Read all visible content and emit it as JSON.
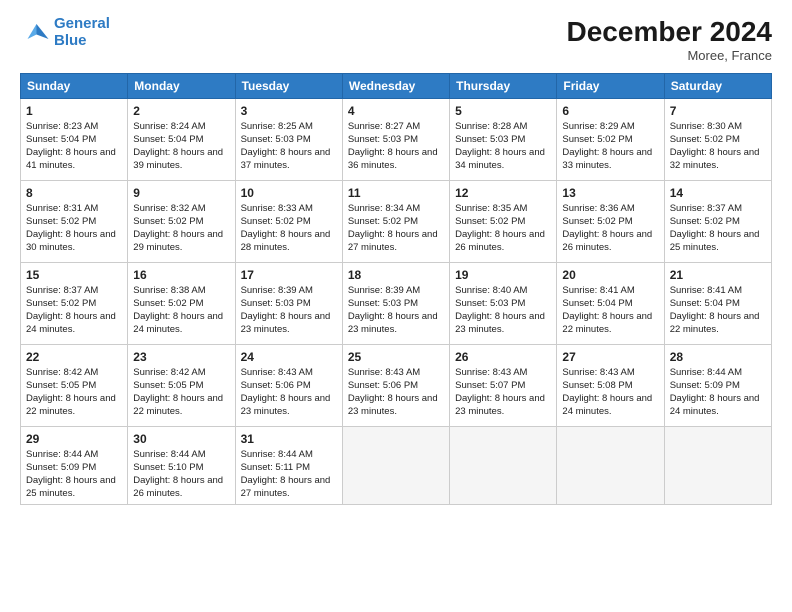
{
  "header": {
    "logo_line1": "General",
    "logo_line2": "Blue",
    "month": "December 2024",
    "location": "Moree, France"
  },
  "weekdays": [
    "Sunday",
    "Monday",
    "Tuesday",
    "Wednesday",
    "Thursday",
    "Friday",
    "Saturday"
  ],
  "weeks": [
    [
      {
        "day": 1,
        "sunrise": "8:23 AM",
        "sunset": "5:04 PM",
        "daylight": "8 hours and 41 minutes."
      },
      {
        "day": 2,
        "sunrise": "8:24 AM",
        "sunset": "5:04 PM",
        "daylight": "8 hours and 39 minutes."
      },
      {
        "day": 3,
        "sunrise": "8:25 AM",
        "sunset": "5:03 PM",
        "daylight": "8 hours and 37 minutes."
      },
      {
        "day": 4,
        "sunrise": "8:27 AM",
        "sunset": "5:03 PM",
        "daylight": "8 hours and 36 minutes."
      },
      {
        "day": 5,
        "sunrise": "8:28 AM",
        "sunset": "5:03 PM",
        "daylight": "8 hours and 34 minutes."
      },
      {
        "day": 6,
        "sunrise": "8:29 AM",
        "sunset": "5:02 PM",
        "daylight": "8 hours and 33 minutes."
      },
      {
        "day": 7,
        "sunrise": "8:30 AM",
        "sunset": "5:02 PM",
        "daylight": "8 hours and 32 minutes."
      }
    ],
    [
      {
        "day": 8,
        "sunrise": "8:31 AM",
        "sunset": "5:02 PM",
        "daylight": "8 hours and 30 minutes."
      },
      {
        "day": 9,
        "sunrise": "8:32 AM",
        "sunset": "5:02 PM",
        "daylight": "8 hours and 29 minutes."
      },
      {
        "day": 10,
        "sunrise": "8:33 AM",
        "sunset": "5:02 PM",
        "daylight": "8 hours and 28 minutes."
      },
      {
        "day": 11,
        "sunrise": "8:34 AM",
        "sunset": "5:02 PM",
        "daylight": "8 hours and 27 minutes."
      },
      {
        "day": 12,
        "sunrise": "8:35 AM",
        "sunset": "5:02 PM",
        "daylight": "8 hours and 26 minutes."
      },
      {
        "day": 13,
        "sunrise": "8:36 AM",
        "sunset": "5:02 PM",
        "daylight": "8 hours and 26 minutes."
      },
      {
        "day": 14,
        "sunrise": "8:37 AM",
        "sunset": "5:02 PM",
        "daylight": "8 hours and 25 minutes."
      }
    ],
    [
      {
        "day": 15,
        "sunrise": "8:37 AM",
        "sunset": "5:02 PM",
        "daylight": "8 hours and 24 minutes."
      },
      {
        "day": 16,
        "sunrise": "8:38 AM",
        "sunset": "5:02 PM",
        "daylight": "8 hours and 24 minutes."
      },
      {
        "day": 17,
        "sunrise": "8:39 AM",
        "sunset": "5:03 PM",
        "daylight": "8 hours and 23 minutes."
      },
      {
        "day": 18,
        "sunrise": "8:39 AM",
        "sunset": "5:03 PM",
        "daylight": "8 hours and 23 minutes."
      },
      {
        "day": 19,
        "sunrise": "8:40 AM",
        "sunset": "5:03 PM",
        "daylight": "8 hours and 23 minutes."
      },
      {
        "day": 20,
        "sunrise": "8:41 AM",
        "sunset": "5:04 PM",
        "daylight": "8 hours and 22 minutes."
      },
      {
        "day": 21,
        "sunrise": "8:41 AM",
        "sunset": "5:04 PM",
        "daylight": "8 hours and 22 minutes."
      }
    ],
    [
      {
        "day": 22,
        "sunrise": "8:42 AM",
        "sunset": "5:05 PM",
        "daylight": "8 hours and 22 minutes."
      },
      {
        "day": 23,
        "sunrise": "8:42 AM",
        "sunset": "5:05 PM",
        "daylight": "8 hours and 22 minutes."
      },
      {
        "day": 24,
        "sunrise": "8:43 AM",
        "sunset": "5:06 PM",
        "daylight": "8 hours and 23 minutes."
      },
      {
        "day": 25,
        "sunrise": "8:43 AM",
        "sunset": "5:06 PM",
        "daylight": "8 hours and 23 minutes."
      },
      {
        "day": 26,
        "sunrise": "8:43 AM",
        "sunset": "5:07 PM",
        "daylight": "8 hours and 23 minutes."
      },
      {
        "day": 27,
        "sunrise": "8:43 AM",
        "sunset": "5:08 PM",
        "daylight": "8 hours and 24 minutes."
      },
      {
        "day": 28,
        "sunrise": "8:44 AM",
        "sunset": "5:09 PM",
        "daylight": "8 hours and 24 minutes."
      }
    ],
    [
      {
        "day": 29,
        "sunrise": "8:44 AM",
        "sunset": "5:09 PM",
        "daylight": "8 hours and 25 minutes."
      },
      {
        "day": 30,
        "sunrise": "8:44 AM",
        "sunset": "5:10 PM",
        "daylight": "8 hours and 26 minutes."
      },
      {
        "day": 31,
        "sunrise": "8:44 AM",
        "sunset": "5:11 PM",
        "daylight": "8 hours and 27 minutes."
      },
      null,
      null,
      null,
      null
    ]
  ]
}
